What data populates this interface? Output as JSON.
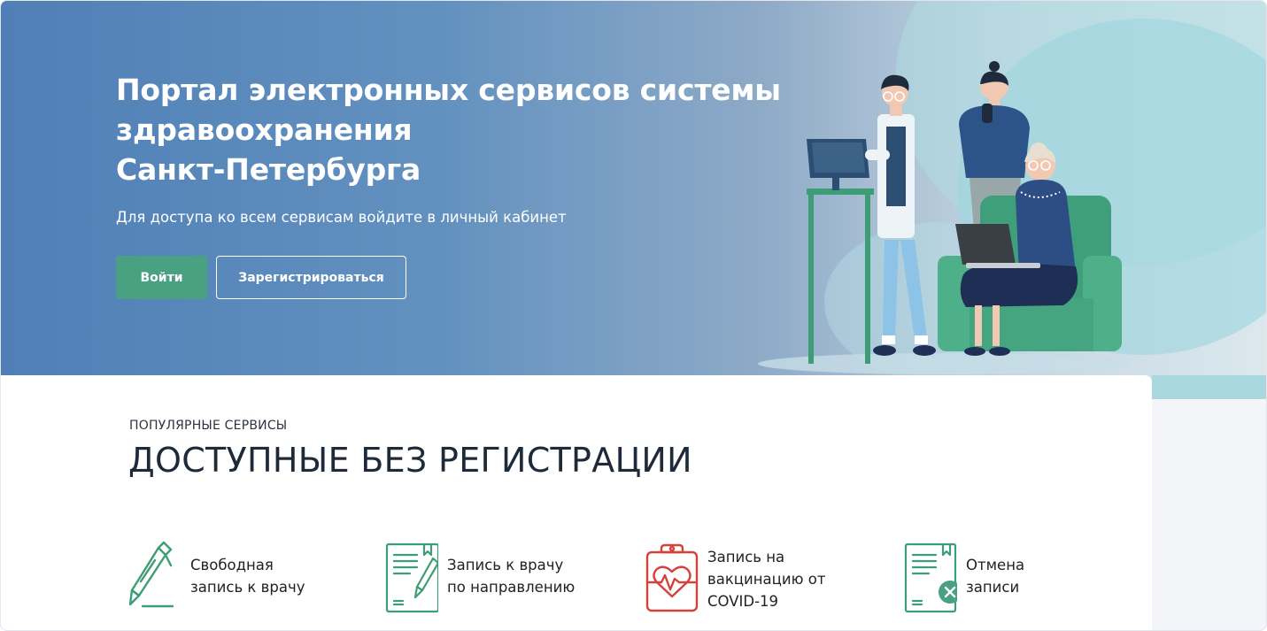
{
  "hero": {
    "title_lines": [
      "Портал электронных сервисов системы",
      "здравоохранения",
      "Санкт-Петербурга"
    ],
    "subtitle": "Для доступа ко всем сервисам войдите в личный кабинет",
    "login_label": "Войти",
    "register_label": "Зарегистрироваться"
  },
  "popular": {
    "eyebrow": "ПОПУЛЯРНЫЕ СЕРВИСЫ",
    "title": "ДОСТУПНЫЕ БЕЗ РЕГИСТРАЦИИ",
    "services": [
      {
        "icon": "pen-icon",
        "lines": [
          "Свободная",
          "запись к врачу"
        ]
      },
      {
        "icon": "document-pen-icon",
        "lines": [
          "Запись к врачу",
          "по направлению"
        ]
      },
      {
        "icon": "heartbeat-clipboard-icon",
        "lines": [
          "Запись на",
          "вакцинацию от",
          "COVID-19"
        ]
      },
      {
        "icon": "document-cancel-icon",
        "lines": [
          "Отмена",
          "записи"
        ]
      }
    ]
  },
  "colors": {
    "accent_green": "#4aa182",
    "hero_blue": "#4f7fb6",
    "covid_red": "#d4433b",
    "title_dark": "#1c2a3a"
  }
}
